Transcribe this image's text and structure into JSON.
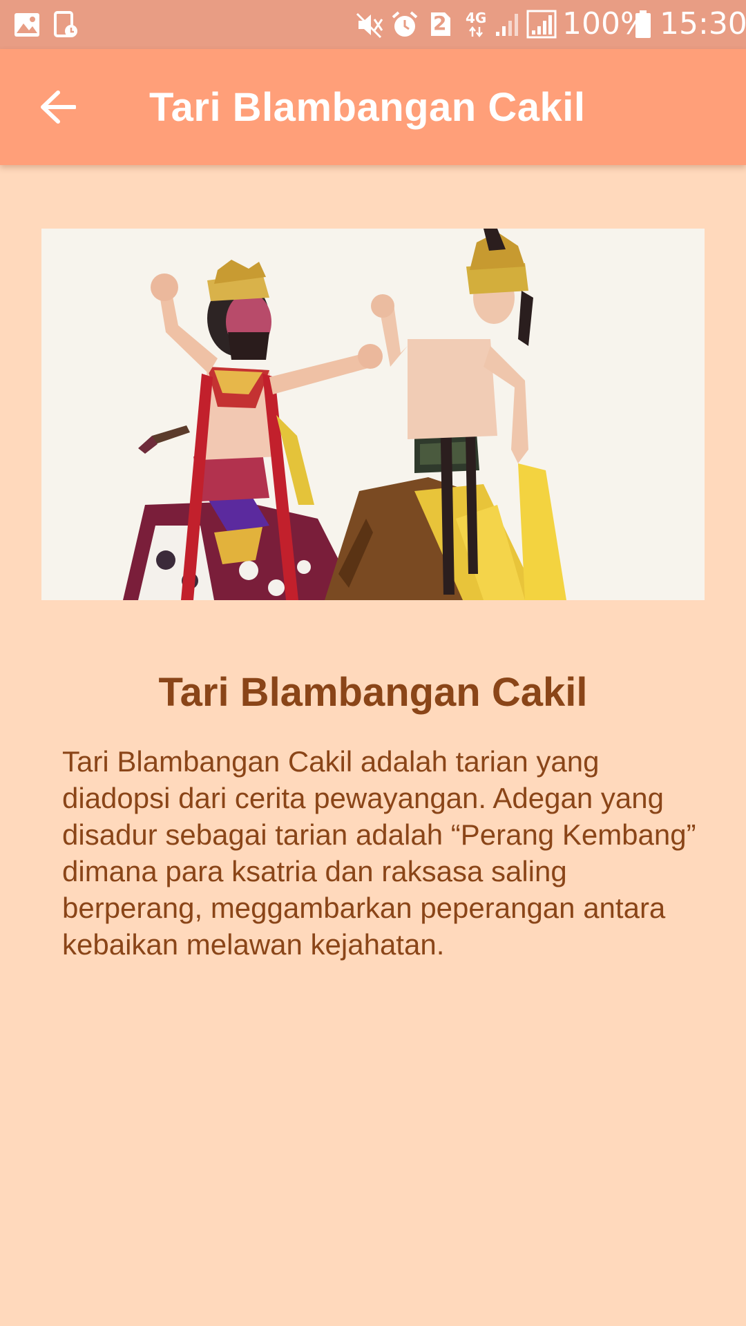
{
  "status_bar": {
    "battery": "100%",
    "time": "15:30",
    "sim_slot": "2",
    "network": "4G",
    "icons": [
      "gallery-icon",
      "screenshot-icon",
      "mute-icon",
      "alarm-icon",
      "sim-icon",
      "data-arrows-icon",
      "signal-icon",
      "signal-icon",
      "battery-icon"
    ]
  },
  "app_bar": {
    "title": "Tari Blambangan Cakil",
    "back_icon": "arrow-back-icon"
  },
  "content": {
    "image_subject": "two-dancers-photo",
    "title": "Tari Blambangan Cakil",
    "body": "Tari Blambangan Cakil adalah tarian yang diadopsi dari cerita pewayangan. Adegan yang disadur sebagai tarian adalah “Perang Kembang” dimana para ksatria dan raksasa saling berperang, meggambarkan peperangan antara kebaikan melawan kejahatan."
  },
  "colors": {
    "status_bar": "#E89D84",
    "app_bar": "#FF9F79",
    "background": "#FFD9BC",
    "text": "#8A4518"
  }
}
